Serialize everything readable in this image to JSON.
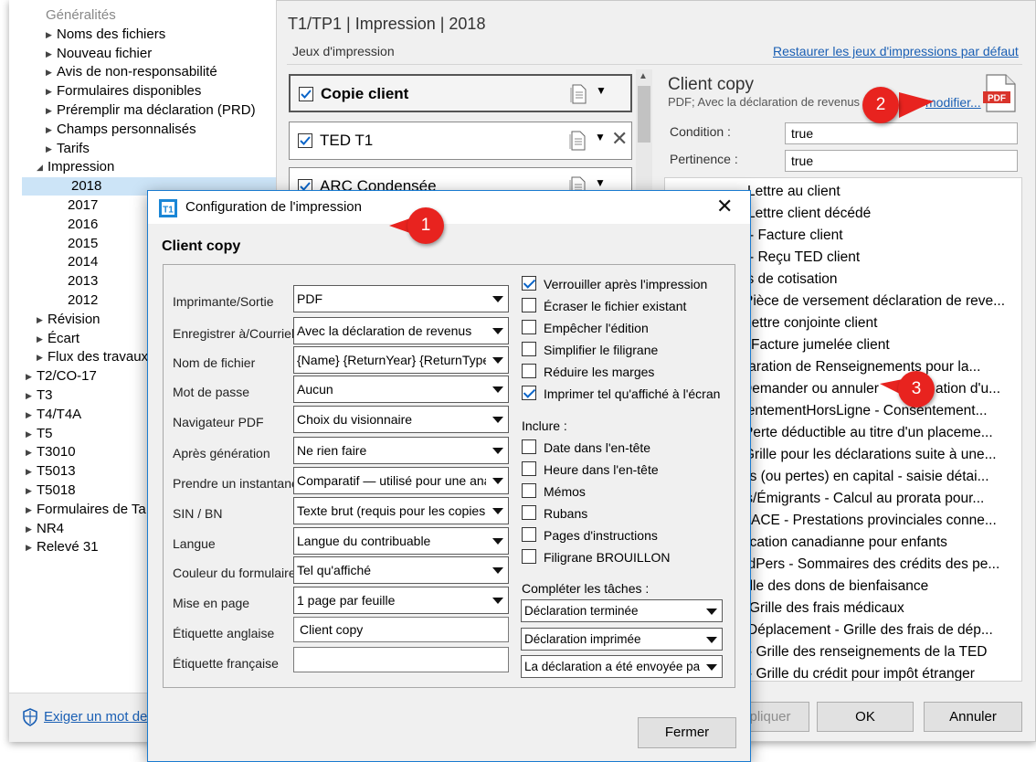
{
  "tree": {
    "items": [
      {
        "label": "Généralités",
        "arrow": "",
        "faded": true
      },
      {
        "label": "Noms des fichiers",
        "arrow": "▶"
      },
      {
        "label": "Nouveau fichier",
        "arrow": "▶"
      },
      {
        "label": "Avis de non-responsabilité",
        "arrow": "▶"
      },
      {
        "label": "Formulaires disponibles",
        "arrow": "▶"
      },
      {
        "label": "Préremplir ma déclaration (PRD)",
        "arrow": "▶"
      },
      {
        "label": "Champs personnalisés",
        "arrow": "▶"
      },
      {
        "label": "Tarifs",
        "arrow": "▶"
      },
      {
        "label": "Impression",
        "arrow": "◢"
      },
      {
        "label": "2018",
        "arrow": "",
        "selected": true
      },
      {
        "label": "2017",
        "arrow": ""
      },
      {
        "label": "2016",
        "arrow": ""
      },
      {
        "label": "2015",
        "arrow": ""
      },
      {
        "label": "2014",
        "arrow": ""
      },
      {
        "label": "2013",
        "arrow": ""
      },
      {
        "label": "2012",
        "arrow": ""
      },
      {
        "label": "Révision",
        "arrow": "▶"
      },
      {
        "label": "Écart",
        "arrow": "▶"
      },
      {
        "label": "Flux des travaux",
        "arrow": "▶"
      },
      {
        "label": "T2/CO-17",
        "arrow": "▶"
      },
      {
        "label": "T3",
        "arrow": "▶"
      },
      {
        "label": "T4/T4A",
        "arrow": "▶"
      },
      {
        "label": "T5",
        "arrow": "▶"
      },
      {
        "label": "T3010",
        "arrow": "▶"
      },
      {
        "label": "T5013",
        "arrow": "▶"
      },
      {
        "label": "T5018",
        "arrow": "▶"
      },
      {
        "label": "Formulaires de Ta",
        "arrow": "▶"
      },
      {
        "label": "NR4",
        "arrow": "▶"
      },
      {
        "label": "Relevé 31",
        "arrow": "▶"
      }
    ],
    "footer_link": "Exiger un mot de"
  },
  "header": {
    "title": "T1/TP1 | Impression | 2018",
    "sets_label": "Jeux d'impression",
    "restore_link": "Restaurer les jeux d'impressions par défaut"
  },
  "sets": [
    {
      "label": "Copie client"
    },
    {
      "label": "TED T1"
    },
    {
      "label": "ARC Condensée"
    }
  ],
  "detail": {
    "title": "Client copy",
    "subtitle": "PDF; Avec la déclaration de revenus",
    "modify_link": "modifier...",
    "pdf_badge": "PDF",
    "condition_label": "Condition :",
    "condition_value": "true",
    "relevance_label": "Pertinence :",
    "relevance_value": "true"
  },
  "reports": [
    "Lettre au client",
    "Lettre client décédé",
    "- Facture client",
    "- Reçu TED client",
    "is de cotisation",
    "Pièce de versement déclaration de reve...",
    "Lettre conjointe client",
    "Facture jumelée client",
    "claration de Renseignements pour la...",
    "Demander ou annuler",
    "sentementHorsLigne - Consentement...",
    "Perte déductible au titre d'un placeme...",
    "Grille pour les déclarations suite à une...",
    "ns (ou pertes) en capital  - saisie détai...",
    "ts/Émigrants - Calcul au prorata pour...",
    "ACE - Prestations provinciales conne...",
    "ocation canadianne pour enfants",
    "édPers - Sommaires des crédits des pe...",
    "rille des dons de bienfaisance",
    "Grille des frais médicaux",
    "Déplacement - Grille des frais de dép...",
    "- Grille des renseignements de la TED",
    "- Grille du crédit pour impôt étranger"
  ],
  "report_extra": "ation d'u...",
  "buttons": {
    "apply": "pliquer",
    "ok": "OK",
    "cancel": "Annuler"
  },
  "dialog": {
    "title": "Configuration de l'impression",
    "heading": "Client copy",
    "app_icon": "T1",
    "fields": [
      {
        "label": "Imprimante/Sortie",
        "value": "PDF",
        "type": "select"
      },
      {
        "label": "Enregistrer à/Courriel",
        "value": "Avec la déclaration de revenus",
        "type": "select"
      },
      {
        "label": "Nom de fichier",
        "value": "{Name} {ReturnYear} {ReturnType} {L",
        "type": "select"
      },
      {
        "label": "Mot de passe",
        "value": "Aucun",
        "type": "select"
      },
      {
        "label": "Navigateur PDF",
        "value": "Choix du visionnaire",
        "type": "select"
      },
      {
        "label": "Après génération",
        "value": "Ne rien faire",
        "type": "select"
      },
      {
        "label": "Prendre un instantané",
        "value": "Comparatif — utilisé pour une analys",
        "type": "select"
      },
      {
        "label": "SIN / BN",
        "value": "Texte brut (requis pour les copies de",
        "type": "select"
      },
      {
        "label": "Langue",
        "value": "Langue du contribuable",
        "type": "select"
      },
      {
        "label": "Couleur du formulaire",
        "value": "Tel qu'affiché",
        "type": "select"
      },
      {
        "label": "Mise en page",
        "value": "1 page par feuille",
        "type": "select"
      },
      {
        "label": "Étiquette anglaise",
        "value": "Client copy",
        "type": "input"
      },
      {
        "label": "Étiquette française",
        "value": "",
        "type": "input"
      }
    ],
    "options": [
      {
        "label": "Verrouiller après l'impression",
        "checked": true
      },
      {
        "label": "Écraser le fichier existant",
        "checked": false
      },
      {
        "label": "Empêcher l'édition",
        "checked": false
      },
      {
        "label": "Simplifier le filigrane",
        "checked": false
      },
      {
        "label": "Réduire les marges",
        "checked": false
      },
      {
        "label": "Imprimer tel qu'affiché à l'écran",
        "checked": true
      }
    ],
    "include_label": "Inclure :",
    "include": [
      {
        "label": "Date dans l'en-tête",
        "checked": false
      },
      {
        "label": "Heure dans l'en-tête",
        "checked": false
      },
      {
        "label": "Mémos",
        "checked": false
      },
      {
        "label": "Rubans",
        "checked": false
      },
      {
        "label": "Pages d'instructions",
        "checked": false
      },
      {
        "label": "Filigrane BROUILLON",
        "checked": false
      }
    ],
    "tasks_label": "Compléter les tâches :",
    "tasks": [
      "Déclaration terminée",
      "Déclaration imprimée",
      "La déclaration a été envoyée par c"
    ],
    "close_button": "Fermer"
  },
  "callouts": [
    "1",
    "2",
    "3"
  ],
  "colors": {
    "link": "#1a5fb4",
    "callout": "#e8231f",
    "selection": "#cce4f7",
    "dialog_border": "#1a7bd0",
    "pdf_red": "#d9342b"
  }
}
